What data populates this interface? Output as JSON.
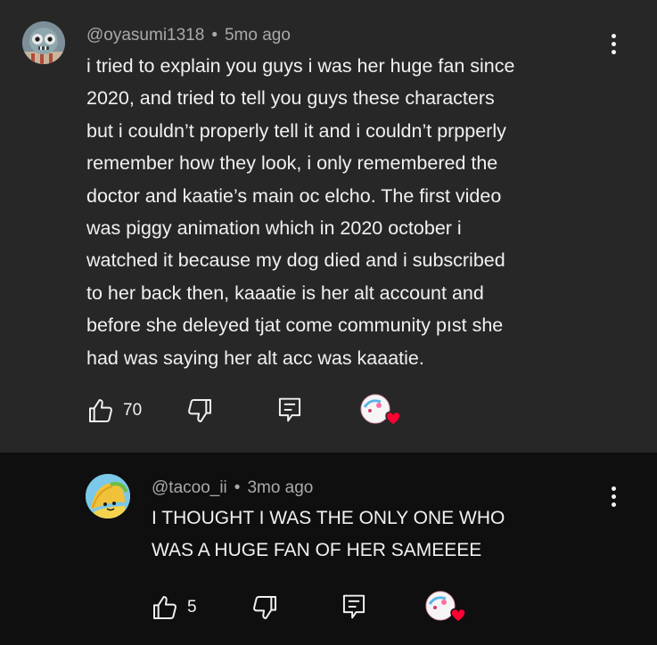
{
  "comments": [
    {
      "author": "@oyasumi1318",
      "separator": "•",
      "time": "5mo ago",
      "lines": [
        "i tried to explain you guys i was her huge fan since",
        "2020, and tried to tell you guys these characters",
        "but i couldn’t properly tell it and i couldn’t prpperly",
        "remember how they look, i only remembered the",
        "doctor and kaatie’s main oc elcho. The first video",
        "was piggy animation which in 2020 october i",
        "watched it because my dog died and i subscribed",
        "to her back then, kaaatie is her alt account and",
        "before she deleyed tjat come community pıst she",
        "had was saying her alt acc was kaaatie."
      ],
      "likes": "70",
      "hearted": true,
      "icons": [
        "avatar",
        "like-icon",
        "dislike-icon",
        "reply-icon",
        "creator-heart-icon",
        "more-vert-icon"
      ]
    },
    {
      "author": "@tacoo_ii",
      "separator": "•",
      "time": "3mo ago",
      "lines": [
        "I THOUGHT I WAS THE ONLY ONE WHO",
        "WAS A HUGE FAN OF HER SAMEEEE"
      ],
      "likes": "5",
      "hearted": true,
      "icons": [
        "avatar",
        "like-icon",
        "dislike-icon",
        "reply-icon",
        "creator-heart-icon",
        "more-vert-icon"
      ]
    }
  ],
  "colors": {
    "main_bg": "#272727",
    "reply_bg": "#0f0f0f",
    "text": "#f1f1f1",
    "meta": "#aaaaaa",
    "heart": "#ff0033"
  }
}
